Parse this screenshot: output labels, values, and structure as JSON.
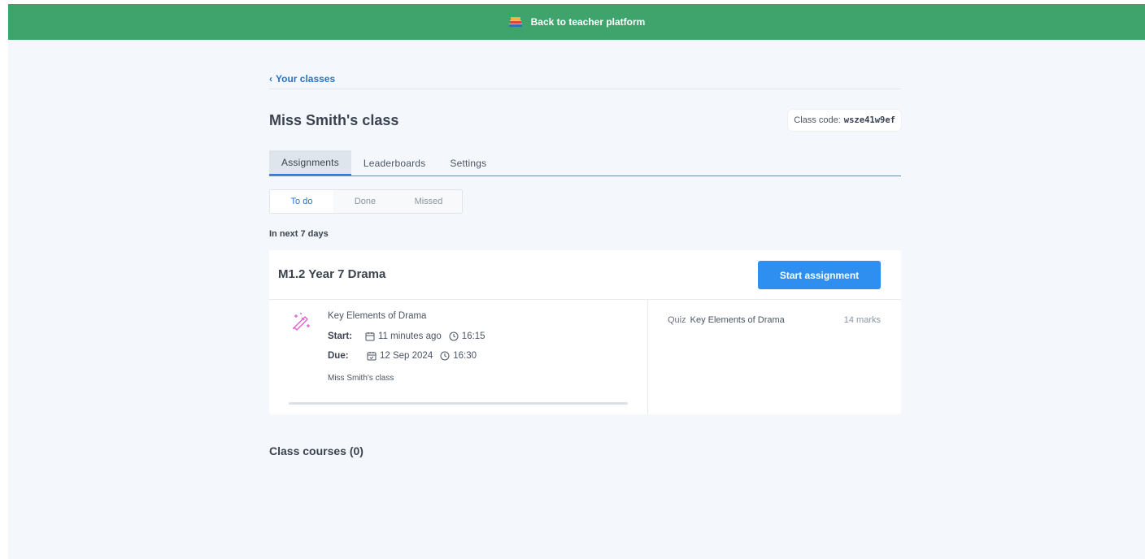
{
  "topbar": {
    "label": "Back to teacher platform",
    "icon": "books-icon"
  },
  "nav": {
    "back_label": "Your classes"
  },
  "class": {
    "title": "Miss Smith's class",
    "code_label": "Class code:",
    "code_value": "wsze41w9ef"
  },
  "tabs": [
    {
      "label": "Assignments",
      "active": true
    },
    {
      "label": "Leaderboards",
      "active": false
    },
    {
      "label": "Settings",
      "active": false
    }
  ],
  "filters": [
    {
      "label": "To do",
      "active": true
    },
    {
      "label": "Done",
      "active": false
    },
    {
      "label": "Missed",
      "active": false
    }
  ],
  "section_label": "In next 7 days",
  "assignment": {
    "title": "M1.2 Year 7 Drama",
    "start_button": "Start assignment",
    "name": "Key Elements of Drama",
    "start_label": "Start:",
    "start_date": "11 minutes ago",
    "start_time": "16:15",
    "due_label": "Due:",
    "due_date": "12 Sep 2024",
    "due_time": "16:30",
    "class_name": "Miss Smith's class",
    "progress": 0,
    "quiz": {
      "type": "Quiz",
      "name": "Key Elements of Drama",
      "marks": "14 marks"
    }
  },
  "courses_heading": "Class courses (0)",
  "colors": {
    "brand_green": "#3fa46c",
    "accent_blue": "#2e8ff0",
    "link_blue": "#2a72c9",
    "magic_pink": "#e05bd0"
  }
}
